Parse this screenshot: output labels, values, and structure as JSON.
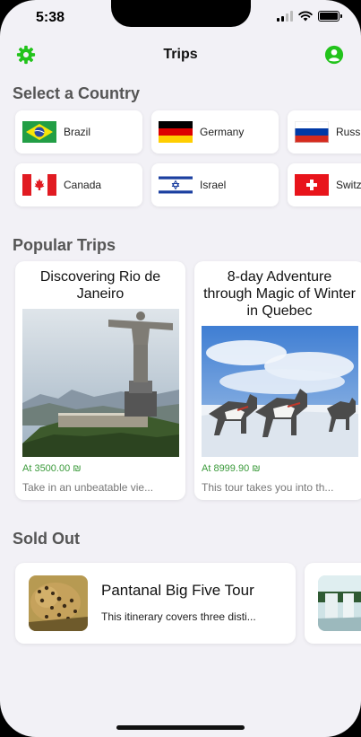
{
  "status_bar": {
    "time": "5:38"
  },
  "nav": {
    "title": "Trips",
    "left_icon": "gear-icon",
    "right_icon": "profile-icon",
    "accent": "#22c31b"
  },
  "sections": {
    "countries": "Select a Country",
    "popular": "Popular Trips",
    "sold_out": "Sold Out"
  },
  "countries": [
    {
      "name": "Brazil",
      "flag": "brazil-flag"
    },
    {
      "name": "Germany",
      "flag": "germany-flag"
    },
    {
      "name": "Russ",
      "flag": "russia-flag"
    },
    {
      "name": "Canada",
      "flag": "canada-flag"
    },
    {
      "name": "Israel",
      "flag": "israel-flag"
    },
    {
      "name": "Switz",
      "flag": "switzerland-flag"
    }
  ],
  "popular_trips": [
    {
      "title": "Discovering Rio de Janeiro",
      "price": "At 3500.00 ₪",
      "description": "Take in an unbeatable vie..."
    },
    {
      "title": "8-day Adventure through Magic of Winter in Quebec",
      "price": "At 8999.90 ₪",
      "description": "This tour takes you into th..."
    }
  ],
  "sold_out": [
    {
      "title": "Pantanal Big Five Tour",
      "description": "This itinerary covers three disti..."
    }
  ],
  "colors": {
    "price_green": "#3a9a3a",
    "background": "#f2f1f6"
  }
}
